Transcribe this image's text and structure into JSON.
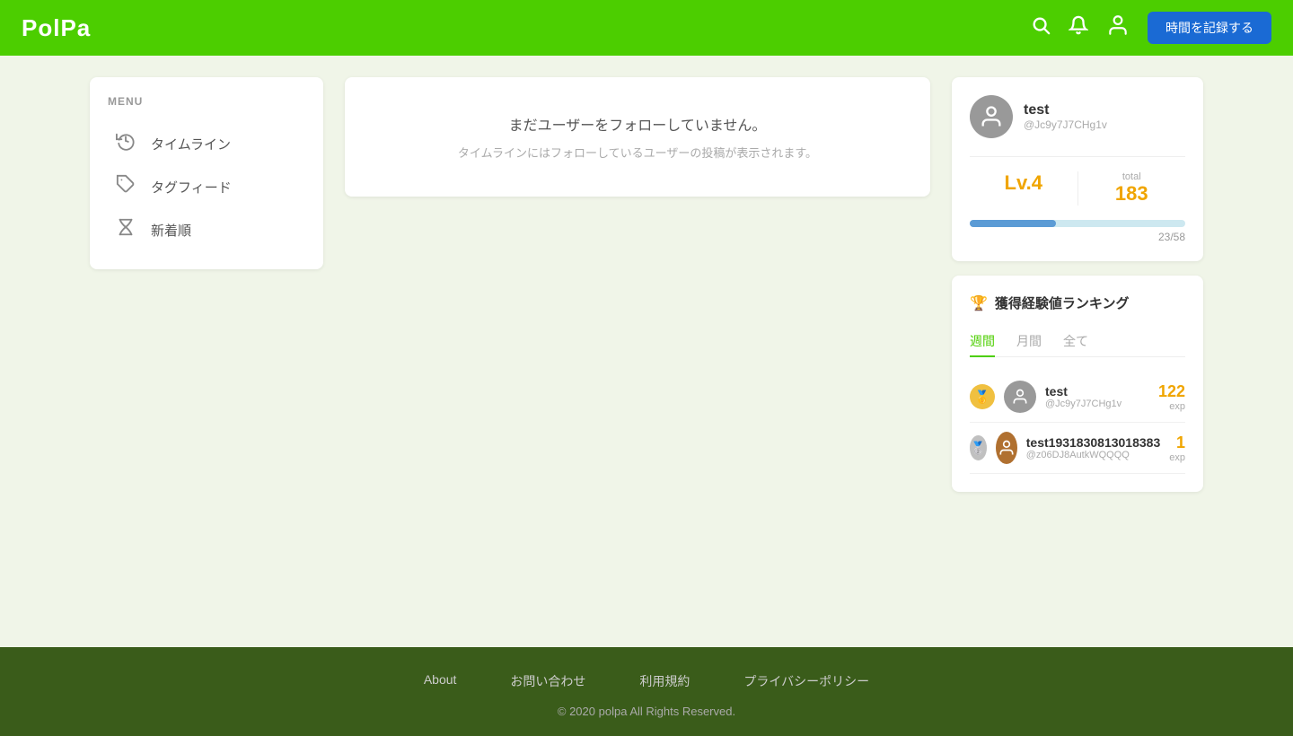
{
  "header": {
    "logo": "PolPa",
    "record_button": "時間を記録する"
  },
  "menu": {
    "title": "MENU",
    "items": [
      {
        "label": "タイムライン",
        "icon": "history-icon"
      },
      {
        "label": "タグフィード",
        "icon": "tag-icon"
      },
      {
        "label": "新着順",
        "icon": "hourglass-icon"
      }
    ]
  },
  "timeline": {
    "empty_title": "まだユーザーをフォローしていません。",
    "empty_sub": "タイムラインにはフォローしているユーザーの投稿が表示されます。"
  },
  "profile": {
    "name": "test",
    "handle": "@Jc9y7J7CHg1v",
    "level_label": "Lv.4",
    "total_label": "total",
    "total_value": "183",
    "progress_current": 23,
    "progress_max": 58,
    "progress_text": "23/58",
    "progress_pct": 40
  },
  "ranking": {
    "trophy_icon": "🏆",
    "title": "獲得経験値ランキング",
    "tabs": [
      "週間",
      "月間",
      "全て"
    ],
    "active_tab": 0,
    "items": [
      {
        "rank": 1,
        "name": "test",
        "handle": "@Jc9y7J7CHg1v",
        "exp": "122",
        "exp_label": "exp"
      },
      {
        "rank": 2,
        "name": "test1931830813018383",
        "handle": "@z06DJ8AutkWQQQQ",
        "exp": "1",
        "exp_label": "exp"
      }
    ]
  },
  "footer": {
    "links": [
      "About",
      "お問い合わせ",
      "利用規約",
      "プライバシーポリシー"
    ],
    "copyright": "© 2020 polpa All Rights Reserved."
  }
}
